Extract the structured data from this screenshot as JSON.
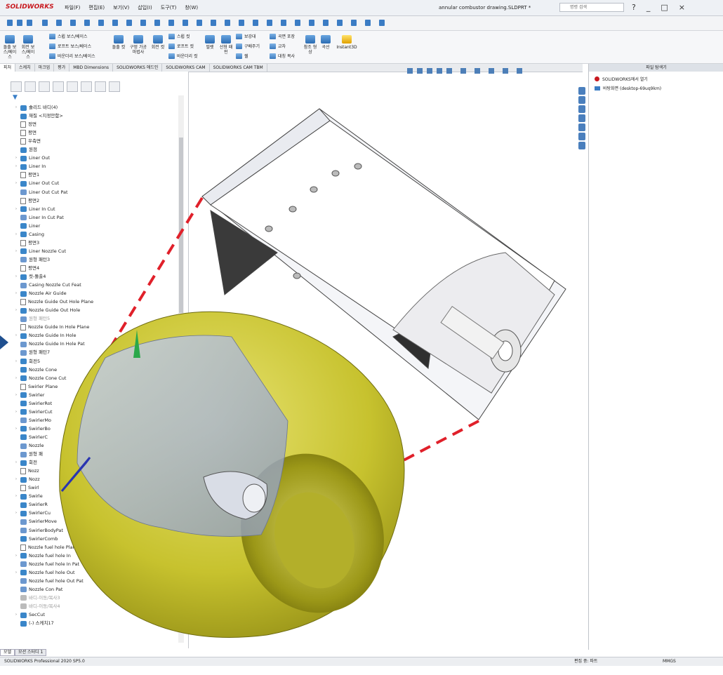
{
  "app": {
    "logo_text": "SOLIDWORKS",
    "menus": [
      "파일(F)",
      "편집(E)",
      "보기(V)",
      "삽입(I)",
      "도구(T)",
      "창(W)"
    ],
    "document_title": "annular combustor drawing.SLDPRT *",
    "search_placeholder": "명령 검색",
    "window_controls": [
      "?",
      "_",
      "□",
      "×"
    ]
  },
  "ribbon": {
    "big_buttons": [
      "돌출 보스/베이스",
      "회전 보스/베이스"
    ],
    "group1": [
      "스윕 보스/베이스",
      "로프트 보스/베이스",
      "바운더리 보스/베이스"
    ],
    "cut_buttons": [
      "돌출 컷",
      "구멍 가공 마법사",
      "회전 컷"
    ],
    "group2": [
      "스윕 컷",
      "로프트 컷",
      "바운더리 컷"
    ],
    "group3_top": [
      "필렛",
      "선형 패턴"
    ],
    "group3": [
      "보강대",
      "구배주기",
      "쉘"
    ],
    "group4": [
      "곡면 포장",
      "교차",
      "대칭 복사"
    ],
    "group5": [
      "참조 형상",
      "곡선",
      "Instant3D"
    ]
  },
  "command_tabs": [
    "피처",
    "스케치",
    "마크업",
    "평가",
    "MBD Dimensions",
    "SOLIDWORKS 애드인",
    "SOLIDWORKS CAM",
    "SOLIDWORKS CAM TBM"
  ],
  "tree": [
    {
      "label": "솔리드 바디(4)",
      "icon": "folder-icon",
      "arrow": true
    },
    {
      "label": "재질 <지정안함>",
      "icon": "material-icon"
    },
    {
      "label": "정면",
      "icon": "plane-icon"
    },
    {
      "label": "평면",
      "icon": "plane-icon"
    },
    {
      "label": "우측면",
      "icon": "plane-icon"
    },
    {
      "label": "원점",
      "icon": "origin-icon"
    },
    {
      "label": "Liner Out",
      "icon": "revolve-icon",
      "arrow": true
    },
    {
      "label": "Liner In",
      "icon": "revolve-icon",
      "arrow": true
    },
    {
      "label": "평면1",
      "icon": "plane-icon"
    },
    {
      "label": "Liner Out Cut",
      "icon": "cut-icon",
      "arrow": true
    },
    {
      "label": "Liner Out Cut Pat",
      "icon": "pattern-icon"
    },
    {
      "label": "평면2",
      "icon": "plane-icon"
    },
    {
      "label": "Liner In Cut",
      "icon": "cut-icon",
      "arrow": true
    },
    {
      "label": "Liner In Cut Pat",
      "icon": "pattern-icon"
    },
    {
      "label": "Liner",
      "icon": "combine-icon"
    },
    {
      "label": "Casing",
      "icon": "revolve-icon",
      "arrow": true
    },
    {
      "label": "평면3",
      "icon": "plane-icon"
    },
    {
      "label": "Liner Nozzle Cut",
      "icon": "cut-icon",
      "arrow": true
    },
    {
      "label": "원형 패턴3",
      "icon": "pattern-icon"
    },
    {
      "label": "평면4",
      "icon": "plane-icon"
    },
    {
      "label": "컷-돌출4",
      "icon": "cut-icon",
      "arrow": true
    },
    {
      "label": "Casing Nozzle Cut Feat",
      "icon": "pattern-icon"
    },
    {
      "label": "Nozzle Air Guide",
      "icon": "revolve-icon",
      "arrow": true
    },
    {
      "label": "Nozzle Guide Out Hole Plane",
      "icon": "plane-icon"
    },
    {
      "label": "Nozzle Guide Out Hole",
      "icon": "cut-icon",
      "arrow": true
    },
    {
      "label": "원형 패턴5",
      "icon": "pattern-icon",
      "dim": true
    },
    {
      "label": "Nozzle Guide In Hole Plane",
      "icon": "plane-icon"
    },
    {
      "label": "Nozzle Guide In Hole",
      "icon": "cut-icon",
      "arrow": true
    },
    {
      "label": "Nozzle Guide In Hole Pat",
      "icon": "pattern-icon"
    },
    {
      "label": "원형 패턴7",
      "icon": "pattern-icon"
    },
    {
      "label": "회전5",
      "icon": "revolve-icon",
      "arrow": true
    },
    {
      "label": "Nozzle Cone",
      "icon": "revolve-icon"
    },
    {
      "label": "Nozzle Cone Cut",
      "icon": "cut-icon",
      "arrow": true
    },
    {
      "label": "Swirler Plane",
      "icon": "plane-icon"
    },
    {
      "label": "Swirler",
      "icon": "revolve-icon",
      "arrow": true
    },
    {
      "label": "SwirlerRot",
      "icon": "revolve-icon"
    },
    {
      "label": "SwirlerCut",
      "icon": "cut-icon",
      "arrow": true
    },
    {
      "label": "SwirlerMo",
      "icon": "pattern-icon"
    },
    {
      "label": "SwirlerBo",
      "icon": "revolve-icon",
      "arrow": true
    },
    {
      "label": "SwirlerC",
      "icon": "combine-icon"
    },
    {
      "label": "Nozzle",
      "icon": "pattern-icon"
    },
    {
      "label": "원형 패",
      "icon": "pattern-icon"
    },
    {
      "label": "회전",
      "icon": "revolve-icon",
      "arrow": true
    },
    {
      "label": "Nozz",
      "icon": "plane-icon"
    },
    {
      "label": "Nozz",
      "icon": "cut-icon",
      "arrow": true
    },
    {
      "label": "Swirl",
      "icon": "plane-icon"
    },
    {
      "label": "Swirle",
      "icon": "revolve-icon",
      "arrow": true
    },
    {
      "label": "SwirlerR",
      "icon": "revolve-icon"
    },
    {
      "label": "SwirlerCu",
      "icon": "cut-icon",
      "arrow": true
    },
    {
      "label": "SwirlerMove",
      "icon": "pattern-icon"
    },
    {
      "label": "SwirlerBodyPat",
      "icon": "pattern-icon"
    },
    {
      "label": "SwirlerComb",
      "icon": "combine-icon"
    },
    {
      "label": "Nozzle fuel hole Plane",
      "icon": "plane-icon"
    },
    {
      "label": "Nozzle fuel hole In",
      "icon": "cut-icon",
      "arrow": true
    },
    {
      "label": "Nozzle fuel hole In Pat",
      "icon": "pattern-icon"
    },
    {
      "label": "Nozzle fuel hole Out",
      "icon": "cut-icon",
      "arrow": true
    },
    {
      "label": "Nozzle fuel hole Out Pat",
      "icon": "pattern-icon"
    },
    {
      "label": "Nozzle Con Pat",
      "icon": "pattern-icon"
    },
    {
      "label": "바디-이동/복사3",
      "icon": "move-icon",
      "dim": true
    },
    {
      "label": "바디-이동/복사4",
      "icon": "move-icon",
      "dim": true
    },
    {
      "label": "SecCut",
      "icon": "cut-icon",
      "arrow": true
    },
    {
      "label": "(-) 스케치17",
      "icon": "sketch-icon"
    }
  ],
  "right_panel": {
    "title": "파일 탐색기",
    "items": [
      "SOLIDWORKS에서 열기",
      "바탕화면 (desktop-69uq9km)"
    ]
  },
  "bottom_tabs": [
    "모델",
    "모션 스터디 1"
  ],
  "status": {
    "version": "SOLIDWORKS Professional 2020 SP5.0",
    "edit_mode": "편집 중: 파트",
    "units": "MMGS"
  },
  "colors": {
    "accent_blue": "#2b6cb3",
    "casing_yellow": "#c7c22e",
    "dashed_red": "#e0202a",
    "brand_red": "#c8191f"
  }
}
